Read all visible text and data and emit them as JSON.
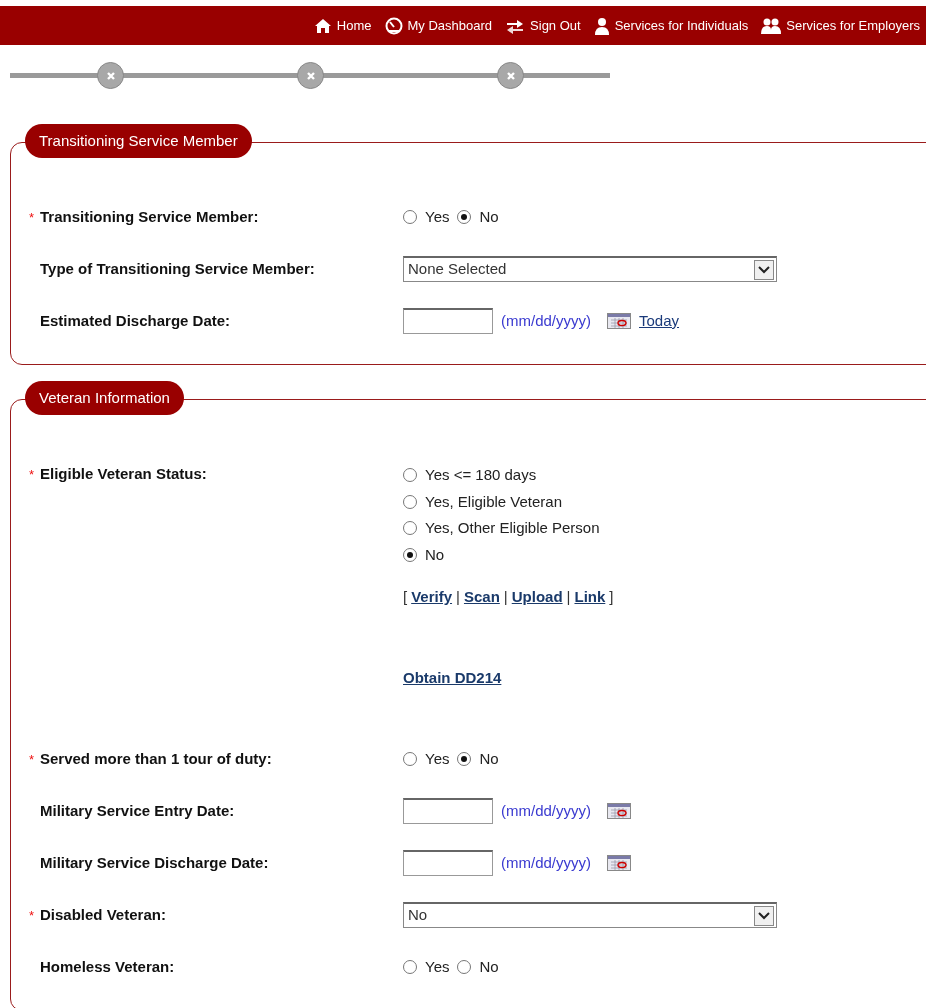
{
  "nav": [
    {
      "label": "Home"
    },
    {
      "label": "My Dashboard"
    },
    {
      "label": "Sign Out"
    },
    {
      "label": "Services for Individuals"
    },
    {
      "label": "Services for Employers"
    }
  ],
  "sections": [
    {
      "title": "Transitioning Service Member",
      "fields": [
        {
          "kind": "radio",
          "label": "Transitioning Service Member:",
          "required_mark": "*",
          "vertical": false,
          "options": [
            {
              "label": "Yes",
              "selected": false
            },
            {
              "label": "No",
              "selected": true
            }
          ]
        },
        {
          "kind": "select",
          "label": "Type of Transitioning Service Member:",
          "value": "None Selected"
        },
        {
          "kind": "date",
          "label": "Estimated Discharge Date:",
          "hint": "(mm/dd/yyyy)",
          "today_link": "Today"
        }
      ]
    },
    {
      "title": "Veteran Information",
      "fields": [
        {
          "kind": "radio",
          "label": "Eligible Veteran Status:",
          "required_mark": "*",
          "vertical": true,
          "options": [
            {
              "label": "Yes <= 180 days",
              "selected": false
            },
            {
              "label": "Yes, Eligible Veteran",
              "selected": false
            },
            {
              "label": "Yes, Other Eligible Person",
              "selected": false
            },
            {
              "label": "No",
              "selected": true
            }
          ]
        },
        {
          "kind": "links",
          "open": "[",
          "separator": "|",
          "close": "]",
          "items": [
            "Verify",
            "Scan",
            "Upload",
            "Link"
          ]
        },
        {
          "kind": "link",
          "text": "Obtain DD214"
        },
        {
          "kind": "radio",
          "label": "Served more than 1 tour of duty:",
          "required_mark": "*",
          "vertical": false,
          "options": [
            {
              "label": "Yes",
              "selected": false
            },
            {
              "label": "No",
              "selected": true
            }
          ]
        },
        {
          "kind": "date",
          "label": "Military Service Entry Date:",
          "hint": "(mm/dd/yyyy)"
        },
        {
          "kind": "date",
          "label": "Military Service Discharge Date:",
          "hint": "(mm/dd/yyyy)"
        },
        {
          "kind": "select",
          "label": "Disabled Veteran:",
          "required_mark": "*",
          "value": "No"
        },
        {
          "kind": "radio",
          "label": "Homeless Veteran:",
          "vertical": false,
          "options": [
            {
              "label": "Yes",
              "selected": false
            },
            {
              "label": "No",
              "selected": false
            }
          ]
        }
      ]
    }
  ]
}
